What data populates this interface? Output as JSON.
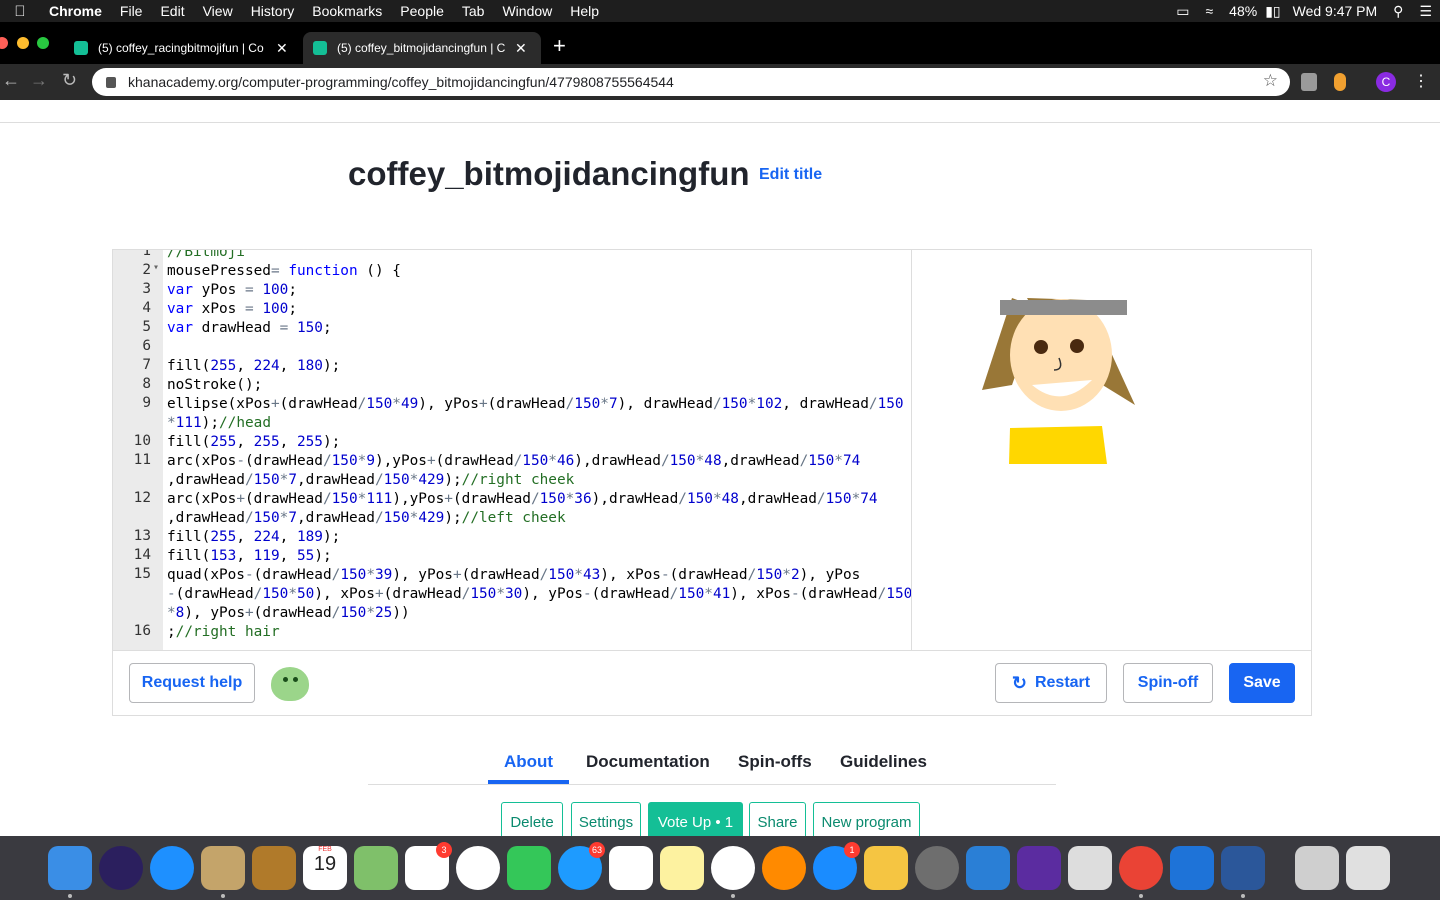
{
  "menubar": {
    "items": [
      "Chrome",
      "File",
      "Edit",
      "View",
      "History",
      "Bookmarks",
      "People",
      "Tab",
      "Window",
      "Help"
    ],
    "battery": "48%",
    "clock": "Wed 9:47 PM"
  },
  "browser": {
    "tabs": [
      {
        "title": "(5) coffey_racingbitmojifun | Co"
      },
      {
        "title": "(5) coffey_bitmojidancingfun | C"
      }
    ],
    "url": "khanacademy.org/computer-programming/coffey_bitmojidancingfun/4779808755564544",
    "profile_initial": "C"
  },
  "program": {
    "title": "coffey_bitmojidancingfun",
    "edit_title": "Edit title"
  },
  "code_lines": [
    {
      "n": "1",
      "text": "//Bitmoji"
    },
    {
      "n": "2",
      "text": "mousePressed= function () {"
    },
    {
      "n": "3",
      "text": "var yPos = 100;"
    },
    {
      "n": "4",
      "text": "var xPos = 100;"
    },
    {
      "n": "5",
      "text": "var drawHead = 150;"
    },
    {
      "n": "6",
      "text": ""
    },
    {
      "n": "7",
      "text": "fill(255, 224, 180);"
    },
    {
      "n": "8",
      "text": "noStroke();"
    },
    {
      "n": "9",
      "text": "ellipse(xPos+(drawHead/150*49), yPos+(drawHead/150*7), drawHead/150*102, drawHead/150"
    },
    {
      "n": "",
      "text": "*111);//head"
    },
    {
      "n": "10",
      "text": "fill(255, 255, 255);"
    },
    {
      "n": "11",
      "text": "arc(xPos-(drawHead/150*9),yPos+(drawHead/150*46),drawHead/150*48,drawHead/150*74"
    },
    {
      "n": "",
      "text": ",drawHead/150*7,drawHead/150*429);//right cheek"
    },
    {
      "n": "12",
      "text": "arc(xPos+(drawHead/150*111),yPos+(drawHead/150*36),drawHead/150*48,drawHead/150*74"
    },
    {
      "n": "",
      "text": ",drawHead/150*7,drawHead/150*429);//left cheek"
    },
    {
      "n": "13",
      "text": "fill(255, 224, 189);"
    },
    {
      "n": "14",
      "text": "fill(153, 119, 55);"
    },
    {
      "n": "15",
      "text": "quad(xPos-(drawHead/150*39), yPos+(drawHead/150*43), xPos-(drawHead/150*2), yPos"
    },
    {
      "n": "",
      "text": "-(drawHead/150*50), xPos+(drawHead/150*30), yPos-(drawHead/150*41), xPos-(drawHead/150"
    },
    {
      "n": "",
      "text": "*8), yPos+(drawHead/150*25))"
    },
    {
      "n": "16",
      "text": ";//right hair"
    }
  ],
  "buttons": {
    "request_help": "Request help",
    "restart": "Restart",
    "spinoff": "Spin-off",
    "save": "Save"
  },
  "page_tabs": [
    "About",
    "Documentation",
    "Spin-offs",
    "Guidelines"
  ],
  "actions": {
    "delete": "Delete",
    "settings": "Settings",
    "vote_up": "Vote Up • 1",
    "share": "Share",
    "new_program": "New program"
  },
  "dock": {
    "calendar_month": "FEB",
    "calendar_day": "19",
    "badges": {
      "reminders": "3",
      "messages": "63",
      "appstore": "1"
    }
  },
  "colors": {
    "ka_blue": "#1865f2",
    "ka_green": "#14bf96",
    "skin": "#ffe0b4",
    "hair": "#997737",
    "shirt": "#ffd700"
  }
}
